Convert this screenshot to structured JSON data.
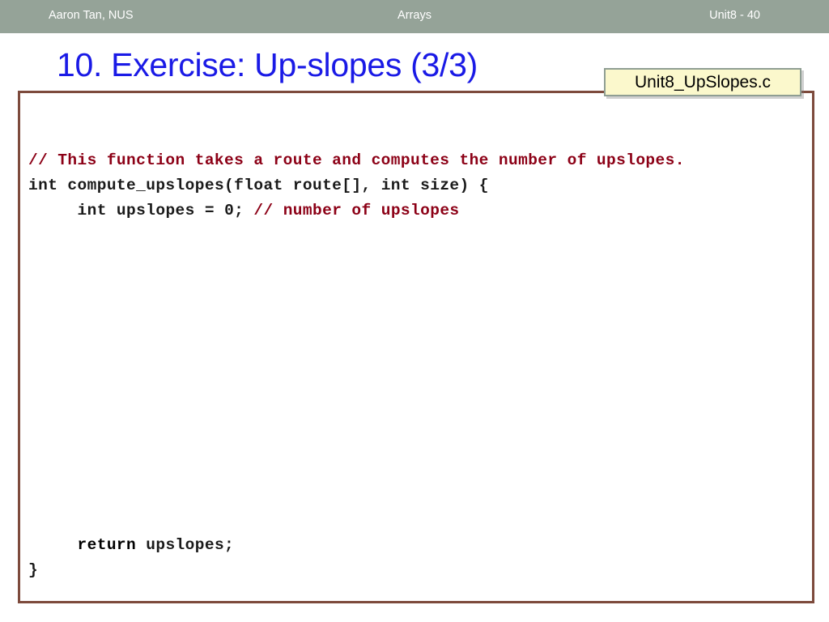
{
  "header": {
    "author": "Aaron Tan, NUS",
    "topic": "Arrays",
    "slide_ref": "Unit8 - 40",
    "bar_color": "#95a398",
    "text_color": "#ffffff"
  },
  "title": {
    "text": "10. Exercise: Up-slopes (3/3)",
    "color": "#1a1ae6"
  },
  "file_badge": {
    "label": "Unit8_UpSlopes.c",
    "fill_color": "#fbf8cc",
    "border_color": "#8f9e93"
  },
  "code_box": {
    "border_color": "#7d4a3c",
    "background": "#ffffff",
    "syntax_colors": {
      "keyword": "#1a1ae6",
      "comment": "#8c0016",
      "number": "#006400",
      "plain": "#1a1a1a"
    },
    "lines": [
      {
        "index": 1,
        "text": "// This function takes a route and computes the number of upslopes.",
        "tokens": [
          {
            "t": "// This function takes a route and computes the number of upslopes.",
            "c": "comment"
          }
        ]
      },
      {
        "index": 2,
        "text": "int compute_upslopes(float route[], int size) {",
        "tokens": [
          {
            "t": "int",
            "c": "keyword"
          },
          {
            "t": " compute_upslopes(",
            "c": "plain"
          },
          {
            "t": "float",
            "c": "keyword"
          },
          {
            "t": " route[], ",
            "c": "plain"
          },
          {
            "t": "int",
            "c": "keyword"
          },
          {
            "t": " size) {",
            "c": "plain"
          }
        ]
      },
      {
        "index": 3,
        "text": "     int upslopes = 0; // number of upslopes",
        "tokens": [
          {
            "t": "     ",
            "c": "plain"
          },
          {
            "t": "int",
            "c": "keyword"
          },
          {
            "t": " upslopes = ",
            "c": "plain"
          },
          {
            "t": "0",
            "c": "number"
          },
          {
            "t": "; ",
            "c": "plain"
          },
          {
            "t": "// number of upslopes",
            "c": "comment"
          }
        ]
      },
      {
        "index": 4,
        "text": "",
        "tokens": []
      },
      {
        "index": 5,
        "text": "",
        "tokens": []
      },
      {
        "index": 6,
        "text": "",
        "tokens": []
      },
      {
        "index": 7,
        "text": "",
        "tokens": []
      },
      {
        "index": 8,
        "text": "",
        "tokens": []
      },
      {
        "index": 9,
        "text": "",
        "tokens": []
      },
      {
        "index": 10,
        "text": "",
        "tokens": []
      },
      {
        "index": 11,
        "text": "",
        "tokens": []
      },
      {
        "index": 12,
        "text": "",
        "tokens": []
      },
      {
        "index": 13,
        "text": "",
        "tokens": []
      },
      {
        "index": 14,
        "text": "",
        "tokens": []
      },
      {
        "index": 15,
        "text": "",
        "tokens": []
      },
      {
        "index": 16,
        "text": "",
        "tokens": []
      }
    ],
    "tail_lines": [
      {
        "index": 17,
        "text": "     return upslopes;",
        "tokens": [
          {
            "t": "     ",
            "c": "plain"
          },
          {
            "t": "return",
            "c": "keyword"
          },
          {
            "t": " upslopes;",
            "c": "plain"
          }
        ]
      },
      {
        "index": 18,
        "text": "}",
        "tokens": [
          {
            "t": "}",
            "c": "plain"
          }
        ]
      }
    ]
  }
}
